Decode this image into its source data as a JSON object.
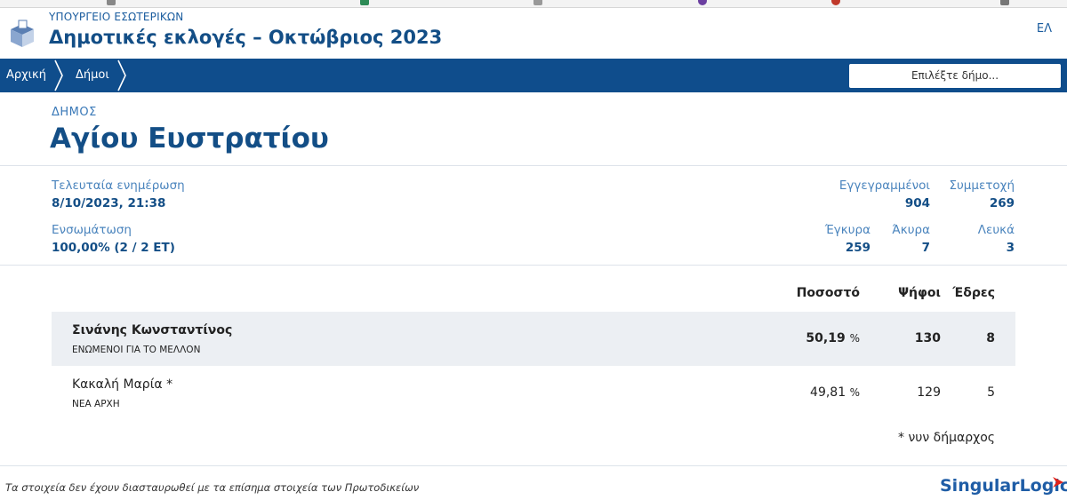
{
  "header": {
    "ministry": "ΥΠΟΥΡΓΕΙΟ ΕΣΩΤΕΡΙΚΩΝ",
    "title": "Δημοτικές εκλογές – Οκτώβριος 2023",
    "language": "ΕΛ",
    "logo_icon": "ballot-box-icon"
  },
  "nav": {
    "crumbs": [
      "Αρχική",
      "Δήμοι"
    ],
    "selector_placeholder": "Επιλέξτε δήμο..."
  },
  "municipality": {
    "label": "ΔΗΜΟΣ",
    "name": "Αγίου Ευστρατίου"
  },
  "stats": {
    "last_update_label": "Τελευταία ενημέρωση",
    "last_update_value": "8/10/2023, 21:38",
    "integration_label": "Ενσωμάτωση",
    "integration_value": "100,00% (2 / 2 ΕΤ)",
    "registered_label": "Εγγεγραμμένοι",
    "registered_value": "904",
    "turnout_label": "Συμμετοχή",
    "turnout_value": "269",
    "valid_label": "Έγκυρα",
    "valid_value": "259",
    "invalid_label": "Άκυρα",
    "invalid_value": "7",
    "blank_label": "Λευκά",
    "blank_value": "3"
  },
  "results": {
    "columns": [
      "Ποσοστό",
      "Ψήφοι",
      "Έδρες"
    ],
    "rows": [
      {
        "name": "Σινάνης Κωνσταντίνος",
        "party": "ΕΝΩΜΕΝΟΙ ΓΙΑ ΤΟ ΜΕΛΛΟΝ",
        "percent": "50,19",
        "percent_sign": "%",
        "votes": "130",
        "seats": "8"
      },
      {
        "name": "Κακαλή Μαρία *",
        "party": "ΝΕΑ ΑΡΧΗ",
        "percent": "49,81",
        "percent_sign": "%",
        "votes": "129",
        "seats": "5"
      }
    ],
    "note": "* νυν δήμαρχος"
  },
  "footer": {
    "disclaimer": "Τα στοιχεία δεν έχουν διασταυρωθεί με τα επίσημα στοιχεία των Πρωτοδικείων",
    "brand_part1": "Singular",
    "brand_part2": "Logic"
  },
  "colors": {
    "nav_bg": "#0f4d8c",
    "title_blue": "#134e86",
    "label_blue": "#4a84bd",
    "row_highlight": "#eceff3",
    "brand_accent": "#e2231a"
  }
}
